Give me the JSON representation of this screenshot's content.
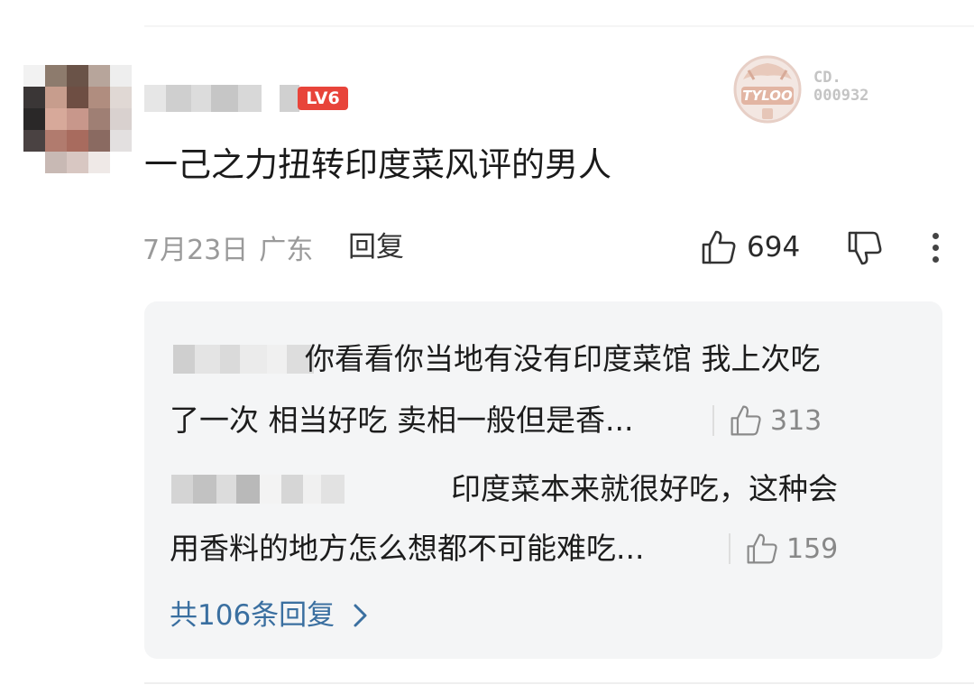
{
  "comment": {
    "level_badge": "LV6",
    "decoration": {
      "text": "TYLOO",
      "id_line1": "CD.",
      "id_line2": "000932"
    },
    "text": "一己之力扭转印度菜风评的男人",
    "date": "7月23日",
    "location": "广东",
    "reply_label": "回复",
    "like_count": "694",
    "icons": {
      "like": "thumbs-up-icon",
      "dislike": "thumbs-down-icon",
      "more": "more-vertical-icon"
    }
  },
  "replies": [
    {
      "line1": "你看看你当地有没有印度菜馆 我上次吃",
      "line2": "了一次 相当好吃 卖相一般但是香...",
      "like_count": "313"
    },
    {
      "line1": "印度菜本来就很好吃，这种会",
      "line2": "用香料的地方怎么想都不可能难吃...",
      "like_count": "159"
    }
  ],
  "view_all_label": "共106条回复",
  "colors": {
    "level_badge": "#e8443a",
    "link": "#3a6fa0",
    "reply_bg": "#f4f5f6"
  }
}
